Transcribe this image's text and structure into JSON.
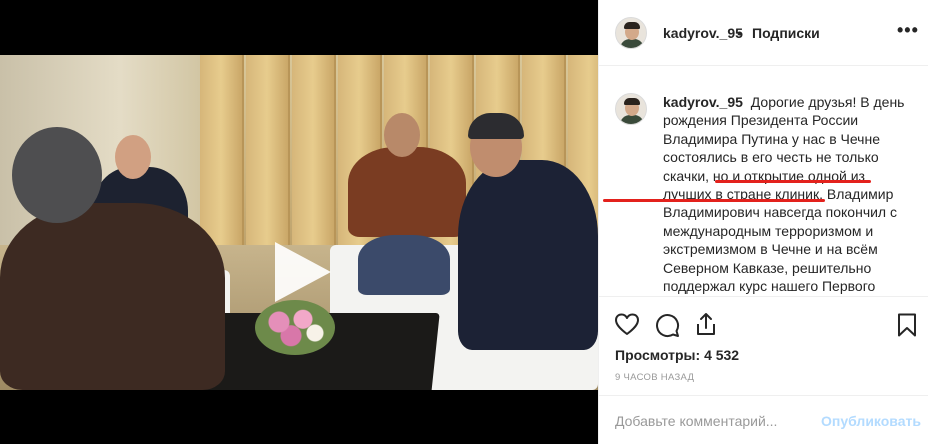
{
  "post": {
    "username": "kadyrov._95",
    "separator": "•",
    "follow_label": "Подписки",
    "more_label": "•••",
    "caption": {
      "username": "kadyrov._95",
      "part1": " Дорогие друзья! В день рождения Президента России Владимира Путина у нас в Чечне состоялись в его честь не только скачки, но и ",
      "part2": "открытие одной из лучших в стране клиник",
      "part3": ". Владимир Владимирович навсегда покончил с международным терроризмом и экстремизмом в Чечне и на всём Северном Кавказе, решительно поддержал курс нашего Первого"
    },
    "views_label": "Просмотры:",
    "views_count": "4 532",
    "time_ago": "9 часов назад",
    "comment_placeholder": "Добавьте комментарий...",
    "publish_label": "Опубликовать"
  },
  "icons": {
    "avatar": "avatar",
    "play": "play-icon",
    "like": "heart-icon",
    "comment": "comment-icon",
    "share": "share-icon",
    "save": "bookmark-icon"
  },
  "colors": {
    "highlight_underline": "#e3211c",
    "publish_disabled": "#b3dbff",
    "muted_text": "#999999"
  }
}
